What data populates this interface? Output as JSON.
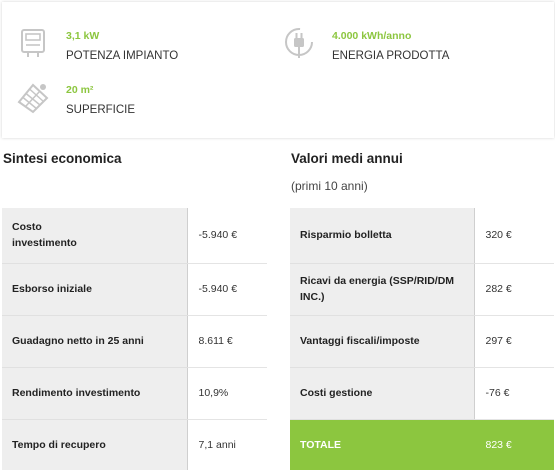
{
  "stats": {
    "power": {
      "value": "3,1 kW",
      "label": "POTENZA IMPIANTO",
      "icon": "meter-icon"
    },
    "energy": {
      "value": "4.000 kWh/anno",
      "label": "ENERGIA PRODOTTA",
      "icon": "plug-icon"
    },
    "surface": {
      "value": "20 m²",
      "label": "SUPERFICIE",
      "icon": "solar-panel-icon"
    }
  },
  "economic": {
    "title": "Sintesi economica",
    "rows": [
      {
        "label": "Costo investimento",
        "value": "-5.940 €"
      },
      {
        "label": "Esborso iniziale",
        "value": "-5.940 €"
      },
      {
        "label": "Guadagno netto in 25 anni",
        "value": "8.611 €"
      },
      {
        "label": "Rendimento investimento",
        "value": "10,9%"
      },
      {
        "label": "Tempo di recupero",
        "value": "7,1 anni"
      }
    ]
  },
  "annual": {
    "title": "Valori medi annui",
    "subtitle": "(primi 10 anni)",
    "rows": [
      {
        "label": "Risparmio bolletta",
        "value": "320 €"
      },
      {
        "label": "Ricavi da energia (SSP/RID/DM INC.)",
        "value": "282 €"
      },
      {
        "label": "Vantaggi fiscali/imposte",
        "value": "297 €"
      },
      {
        "label": "Costi gestione",
        "value": "-76 €"
      },
      {
        "label": "TOTALE",
        "value": "823 €"
      }
    ]
  },
  "colors": {
    "accent": "#8cc63f",
    "row_bg": "#eeeeee",
    "icon": "#c8c8c8"
  }
}
